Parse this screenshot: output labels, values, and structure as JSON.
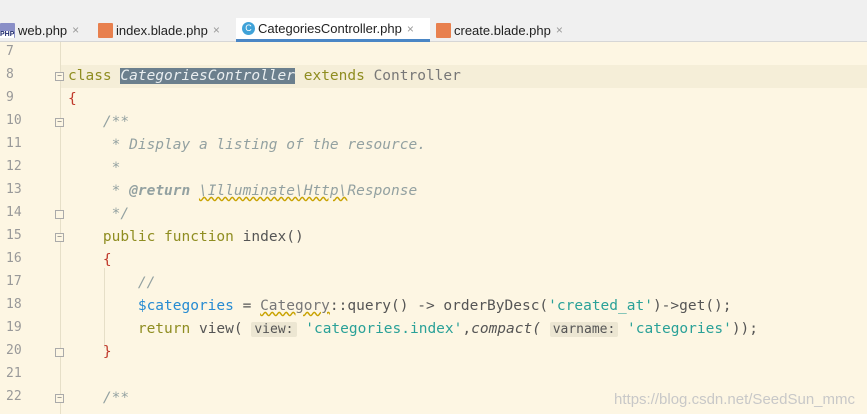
{
  "tabs": [
    {
      "label": "web.php",
      "icon": "php-file-icon",
      "icon_text": "PHP",
      "active": false
    },
    {
      "label": "index.blade.php",
      "icon": "blade-file-icon",
      "active": false
    },
    {
      "label": "CategoriesController.php",
      "icon": "class-file-icon",
      "icon_text": "C",
      "active": true
    },
    {
      "label": "create.blade.php",
      "icon": "blade-file-icon",
      "active": false
    }
  ],
  "close_glyph": "×",
  "line_numbers": [
    "7",
    "8",
    "9",
    "10",
    "11",
    "12",
    "13",
    "14",
    "15",
    "16",
    "17",
    "18",
    "19",
    "20",
    "21",
    "22"
  ],
  "code": {
    "l8_class": "class",
    "l8_name": "CategoriesController",
    "l8_extends": "extends",
    "l8_parent": "Controller",
    "l9": "{",
    "l10": "/**",
    "l11": " * Display a listing of the resource.",
    "l12": " *",
    "l13_star": " * ",
    "l13_tag": "@return",
    "l13_type": "\\Illuminate\\Http\\",
    "l13_resp": "Response",
    "l14": " */",
    "l15_public": "public",
    "l15_function": "function",
    "l15_name": "index()",
    "l16": "{",
    "l17": "//",
    "l18_var": "$categories",
    "l18_eq": " = ",
    "l18_class": "Category",
    "l18_rest1": "::query() -> orderByDesc(",
    "l18_str": "'created_at'",
    "l18_rest2": ")->get();",
    "l19_return": "return",
    "l19_view": " view(",
    "l19_hint1": "view:",
    "l19_str1": "'categories.index'",
    "l19_comma": ",",
    "l19_compact": "compact(",
    "l19_hint2": "varname:",
    "l19_str2": "'categories'",
    "l19_end": "));",
    "l20": "}",
    "l22": "/**"
  },
  "watermark": "https://blog.csdn.net/SeedSun_mmc"
}
